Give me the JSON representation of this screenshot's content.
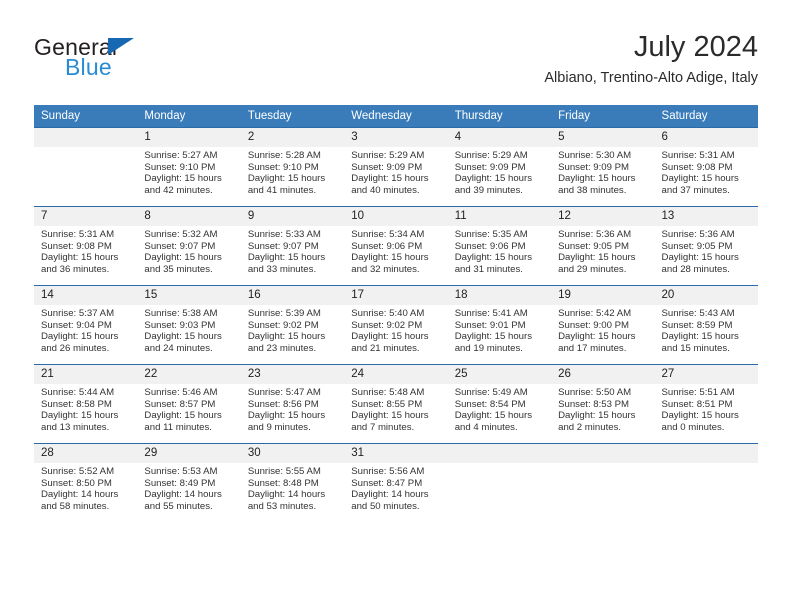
{
  "brand": {
    "name_part1": "General",
    "name_part2": "Blue",
    "triangle_color": "#1668b3",
    "blue_color": "#2a8bd5"
  },
  "header": {
    "title": "July 2024",
    "subtitle": "Albiano, Trentino-Alto Adige, Italy"
  },
  "theme": {
    "header_bg": "#3a7cba",
    "header_text": "#ffffff",
    "row_divider": "#2a6aa8",
    "daynum_bg": "#f1f1f1"
  },
  "calendar": {
    "weekday_headers": [
      "Sunday",
      "Monday",
      "Tuesday",
      "Wednesday",
      "Thursday",
      "Friday",
      "Saturday"
    ],
    "labels": {
      "sunrise": "Sunrise:",
      "sunset": "Sunset:",
      "daylight": "Daylight:"
    },
    "weeks": [
      [
        {
          "day": "",
          "blank": true,
          "sunrise": "",
          "sunset": "",
          "daylight_line1": "",
          "daylight_line2": ""
        },
        {
          "day": "1",
          "blank": false,
          "sunrise": "Sunrise: 5:27 AM",
          "sunset": "Sunset: 9:10 PM",
          "daylight_line1": "Daylight: 15 hours",
          "daylight_line2": "and 42 minutes."
        },
        {
          "day": "2",
          "blank": false,
          "sunrise": "Sunrise: 5:28 AM",
          "sunset": "Sunset: 9:10 PM",
          "daylight_line1": "Daylight: 15 hours",
          "daylight_line2": "and 41 minutes."
        },
        {
          "day": "3",
          "blank": false,
          "sunrise": "Sunrise: 5:29 AM",
          "sunset": "Sunset: 9:09 PM",
          "daylight_line1": "Daylight: 15 hours",
          "daylight_line2": "and 40 minutes."
        },
        {
          "day": "4",
          "blank": false,
          "sunrise": "Sunrise: 5:29 AM",
          "sunset": "Sunset: 9:09 PM",
          "daylight_line1": "Daylight: 15 hours",
          "daylight_line2": "and 39 minutes."
        },
        {
          "day": "5",
          "blank": false,
          "sunrise": "Sunrise: 5:30 AM",
          "sunset": "Sunset: 9:09 PM",
          "daylight_line1": "Daylight: 15 hours",
          "daylight_line2": "and 38 minutes."
        },
        {
          "day": "6",
          "blank": false,
          "sunrise": "Sunrise: 5:31 AM",
          "sunset": "Sunset: 9:08 PM",
          "daylight_line1": "Daylight: 15 hours",
          "daylight_line2": "and 37 minutes."
        }
      ],
      [
        {
          "day": "7",
          "blank": false,
          "sunrise": "Sunrise: 5:31 AM",
          "sunset": "Sunset: 9:08 PM",
          "daylight_line1": "Daylight: 15 hours",
          "daylight_line2": "and 36 minutes."
        },
        {
          "day": "8",
          "blank": false,
          "sunrise": "Sunrise: 5:32 AM",
          "sunset": "Sunset: 9:07 PM",
          "daylight_line1": "Daylight: 15 hours",
          "daylight_line2": "and 35 minutes."
        },
        {
          "day": "9",
          "blank": false,
          "sunrise": "Sunrise: 5:33 AM",
          "sunset": "Sunset: 9:07 PM",
          "daylight_line1": "Daylight: 15 hours",
          "daylight_line2": "and 33 minutes."
        },
        {
          "day": "10",
          "blank": false,
          "sunrise": "Sunrise: 5:34 AM",
          "sunset": "Sunset: 9:06 PM",
          "daylight_line1": "Daylight: 15 hours",
          "daylight_line2": "and 32 minutes."
        },
        {
          "day": "11",
          "blank": false,
          "sunrise": "Sunrise: 5:35 AM",
          "sunset": "Sunset: 9:06 PM",
          "daylight_line1": "Daylight: 15 hours",
          "daylight_line2": "and 31 minutes."
        },
        {
          "day": "12",
          "blank": false,
          "sunrise": "Sunrise: 5:36 AM",
          "sunset": "Sunset: 9:05 PM",
          "daylight_line1": "Daylight: 15 hours",
          "daylight_line2": "and 29 minutes."
        },
        {
          "day": "13",
          "blank": false,
          "sunrise": "Sunrise: 5:36 AM",
          "sunset": "Sunset: 9:05 PM",
          "daylight_line1": "Daylight: 15 hours",
          "daylight_line2": "and 28 minutes."
        }
      ],
      [
        {
          "day": "14",
          "blank": false,
          "sunrise": "Sunrise: 5:37 AM",
          "sunset": "Sunset: 9:04 PM",
          "daylight_line1": "Daylight: 15 hours",
          "daylight_line2": "and 26 minutes."
        },
        {
          "day": "15",
          "blank": false,
          "sunrise": "Sunrise: 5:38 AM",
          "sunset": "Sunset: 9:03 PM",
          "daylight_line1": "Daylight: 15 hours",
          "daylight_line2": "and 24 minutes."
        },
        {
          "day": "16",
          "blank": false,
          "sunrise": "Sunrise: 5:39 AM",
          "sunset": "Sunset: 9:02 PM",
          "daylight_line1": "Daylight: 15 hours",
          "daylight_line2": "and 23 minutes."
        },
        {
          "day": "17",
          "blank": false,
          "sunrise": "Sunrise: 5:40 AM",
          "sunset": "Sunset: 9:02 PM",
          "daylight_line1": "Daylight: 15 hours",
          "daylight_line2": "and 21 minutes."
        },
        {
          "day": "18",
          "blank": false,
          "sunrise": "Sunrise: 5:41 AM",
          "sunset": "Sunset: 9:01 PM",
          "daylight_line1": "Daylight: 15 hours",
          "daylight_line2": "and 19 minutes."
        },
        {
          "day": "19",
          "blank": false,
          "sunrise": "Sunrise: 5:42 AM",
          "sunset": "Sunset: 9:00 PM",
          "daylight_line1": "Daylight: 15 hours",
          "daylight_line2": "and 17 minutes."
        },
        {
          "day": "20",
          "blank": false,
          "sunrise": "Sunrise: 5:43 AM",
          "sunset": "Sunset: 8:59 PM",
          "daylight_line1": "Daylight: 15 hours",
          "daylight_line2": "and 15 minutes."
        }
      ],
      [
        {
          "day": "21",
          "blank": false,
          "sunrise": "Sunrise: 5:44 AM",
          "sunset": "Sunset: 8:58 PM",
          "daylight_line1": "Daylight: 15 hours",
          "daylight_line2": "and 13 minutes."
        },
        {
          "day": "22",
          "blank": false,
          "sunrise": "Sunrise: 5:46 AM",
          "sunset": "Sunset: 8:57 PM",
          "daylight_line1": "Daylight: 15 hours",
          "daylight_line2": "and 11 minutes."
        },
        {
          "day": "23",
          "blank": false,
          "sunrise": "Sunrise: 5:47 AM",
          "sunset": "Sunset: 8:56 PM",
          "daylight_line1": "Daylight: 15 hours",
          "daylight_line2": "and 9 minutes."
        },
        {
          "day": "24",
          "blank": false,
          "sunrise": "Sunrise: 5:48 AM",
          "sunset": "Sunset: 8:55 PM",
          "daylight_line1": "Daylight: 15 hours",
          "daylight_line2": "and 7 minutes."
        },
        {
          "day": "25",
          "blank": false,
          "sunrise": "Sunrise: 5:49 AM",
          "sunset": "Sunset: 8:54 PM",
          "daylight_line1": "Daylight: 15 hours",
          "daylight_line2": "and 4 minutes."
        },
        {
          "day": "26",
          "blank": false,
          "sunrise": "Sunrise: 5:50 AM",
          "sunset": "Sunset: 8:53 PM",
          "daylight_line1": "Daylight: 15 hours",
          "daylight_line2": "and 2 minutes."
        },
        {
          "day": "27",
          "blank": false,
          "sunrise": "Sunrise: 5:51 AM",
          "sunset": "Sunset: 8:51 PM",
          "daylight_line1": "Daylight: 15 hours",
          "daylight_line2": "and 0 minutes."
        }
      ],
      [
        {
          "day": "28",
          "blank": false,
          "sunrise": "Sunrise: 5:52 AM",
          "sunset": "Sunset: 8:50 PM",
          "daylight_line1": "Daylight: 14 hours",
          "daylight_line2": "and 58 minutes."
        },
        {
          "day": "29",
          "blank": false,
          "sunrise": "Sunrise: 5:53 AM",
          "sunset": "Sunset: 8:49 PM",
          "daylight_line1": "Daylight: 14 hours",
          "daylight_line2": "and 55 minutes."
        },
        {
          "day": "30",
          "blank": false,
          "sunrise": "Sunrise: 5:55 AM",
          "sunset": "Sunset: 8:48 PM",
          "daylight_line1": "Daylight: 14 hours",
          "daylight_line2": "and 53 minutes."
        },
        {
          "day": "31",
          "blank": false,
          "sunrise": "Sunrise: 5:56 AM",
          "sunset": "Sunset: 8:47 PM",
          "daylight_line1": "Daylight: 14 hours",
          "daylight_line2": "and 50 minutes."
        },
        {
          "day": "",
          "blank": true,
          "sunrise": "",
          "sunset": "",
          "daylight_line1": "",
          "daylight_line2": ""
        },
        {
          "day": "",
          "blank": true,
          "sunrise": "",
          "sunset": "",
          "daylight_line1": "",
          "daylight_line2": ""
        },
        {
          "day": "",
          "blank": true,
          "sunrise": "",
          "sunset": "",
          "daylight_line1": "",
          "daylight_line2": ""
        }
      ]
    ]
  }
}
